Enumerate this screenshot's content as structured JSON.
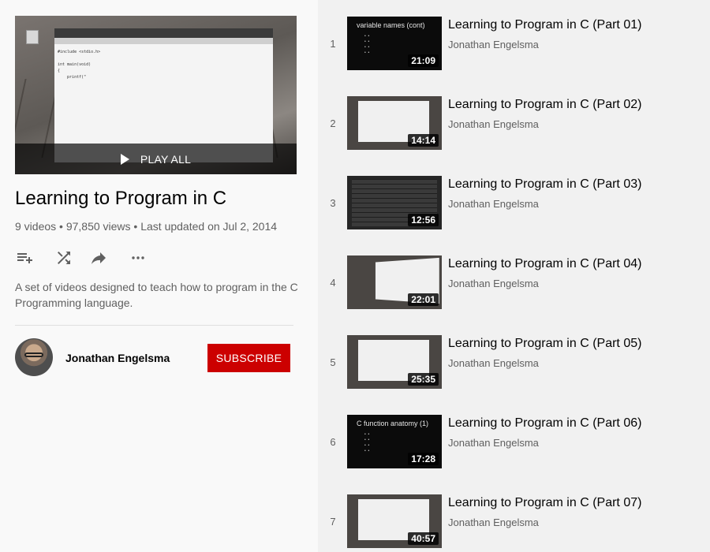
{
  "playlist": {
    "play_all_label": "PLAY ALL",
    "title": "Learning to Program in C",
    "stats": "9 videos • 97,850 views • Last updated on Jul 2, 2014",
    "description": "A set of videos designed to teach how to program in the C Programming language.",
    "actions": [
      "add-to-queue-icon",
      "shuffle-icon",
      "share-icon",
      "more-icon"
    ],
    "owner": {
      "name": "Jonathan Engelsma",
      "subscribe_label": "SUBSCRIBE"
    },
    "colors": {
      "subscribe": "#cc0000",
      "panel_left": "#f9f9f9",
      "panel_right": "#f1f1f1"
    }
  },
  "videos": [
    {
      "index": "1",
      "title": "Learning to Program in C (Part 01)",
      "channel": "Jonathan Engelsma",
      "duration": "21:09",
      "thumb": "dark",
      "slide_title": "variable names (cont)"
    },
    {
      "index": "2",
      "title": "Learning to Program in C (Part 02)",
      "channel": "Jonathan Engelsma",
      "duration": "14:14",
      "thumb": "screen"
    },
    {
      "index": "3",
      "title": "Learning to Program in C (Part 03)",
      "channel": "Jonathan Engelsma",
      "duration": "12:56",
      "thumb": "table"
    },
    {
      "index": "4",
      "title": "Learning to Program in C (Part 04)",
      "channel": "Jonathan Engelsma",
      "duration": "22:01",
      "thumb": "tilt"
    },
    {
      "index": "5",
      "title": "Learning to Program in C (Part 05)",
      "channel": "Jonathan Engelsma",
      "duration": "25:35",
      "thumb": "screen"
    },
    {
      "index": "6",
      "title": "Learning to Program in C (Part 06)",
      "channel": "Jonathan Engelsma",
      "duration": "17:28",
      "thumb": "dark",
      "slide_title": "C function anatomy (1)"
    },
    {
      "index": "7",
      "title": "Learning to Program in C (Part 07)",
      "channel": "Jonathan Engelsma",
      "duration": "40:57",
      "thumb": "screen"
    }
  ]
}
